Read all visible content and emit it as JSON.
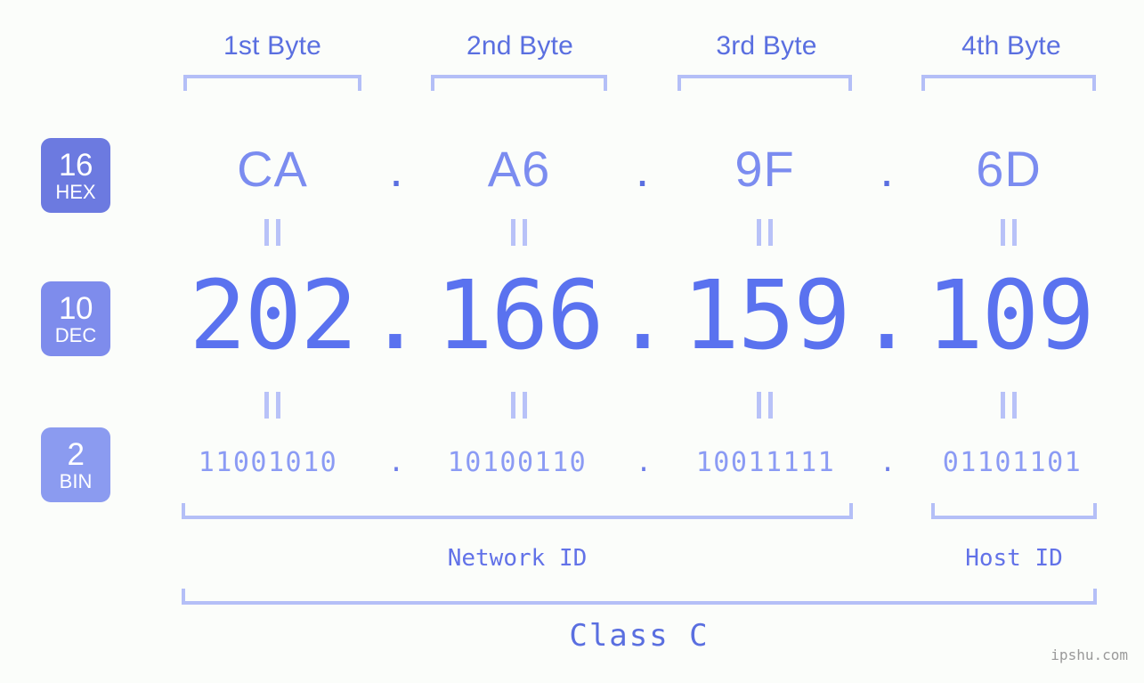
{
  "ip": {
    "decimal": "202.166.159.109",
    "hex": "CA.A6.9F.6D",
    "binary": "11001010.10100110.10011111.01101101",
    "class": "Class C"
  },
  "colors": {
    "background": "#fbfdfa",
    "accent_strong": "#5a6fe0",
    "accent_mid": "#7b8cf0",
    "accent_light": "#8b9bf4",
    "bracket": "#b4bff7",
    "separator": "#b8c2f8",
    "badge_hex": "#6c7ae0",
    "badge_dec": "#7e8cec",
    "badge_bin": "#8b9bf0",
    "watermark": "#9a9a9a"
  },
  "header": {
    "bytes": [
      {
        "label": "1st Byte"
      },
      {
        "label": "2nd Byte"
      },
      {
        "label": "3rd Byte"
      },
      {
        "label": "4th Byte"
      }
    ]
  },
  "radix_badges": [
    {
      "number": "16",
      "name": "HEX"
    },
    {
      "number": "10",
      "name": "DEC"
    },
    {
      "number": "2",
      "name": "BIN"
    }
  ],
  "rows": {
    "hex": {
      "values": [
        "CA",
        "A6",
        "9F",
        "6D"
      ],
      "separator": "."
    },
    "dec": {
      "values": [
        "202",
        "166",
        "159",
        "109"
      ],
      "separator": "."
    },
    "bin": {
      "values": [
        "11001010",
        "10100110",
        "10011111",
        "01101101"
      ],
      "separator": "."
    }
  },
  "equals_marker": "=",
  "sections": {
    "network_id": "Network ID",
    "host_id": "Host ID",
    "class_label": "Class C"
  },
  "watermark": "ipshu.com"
}
